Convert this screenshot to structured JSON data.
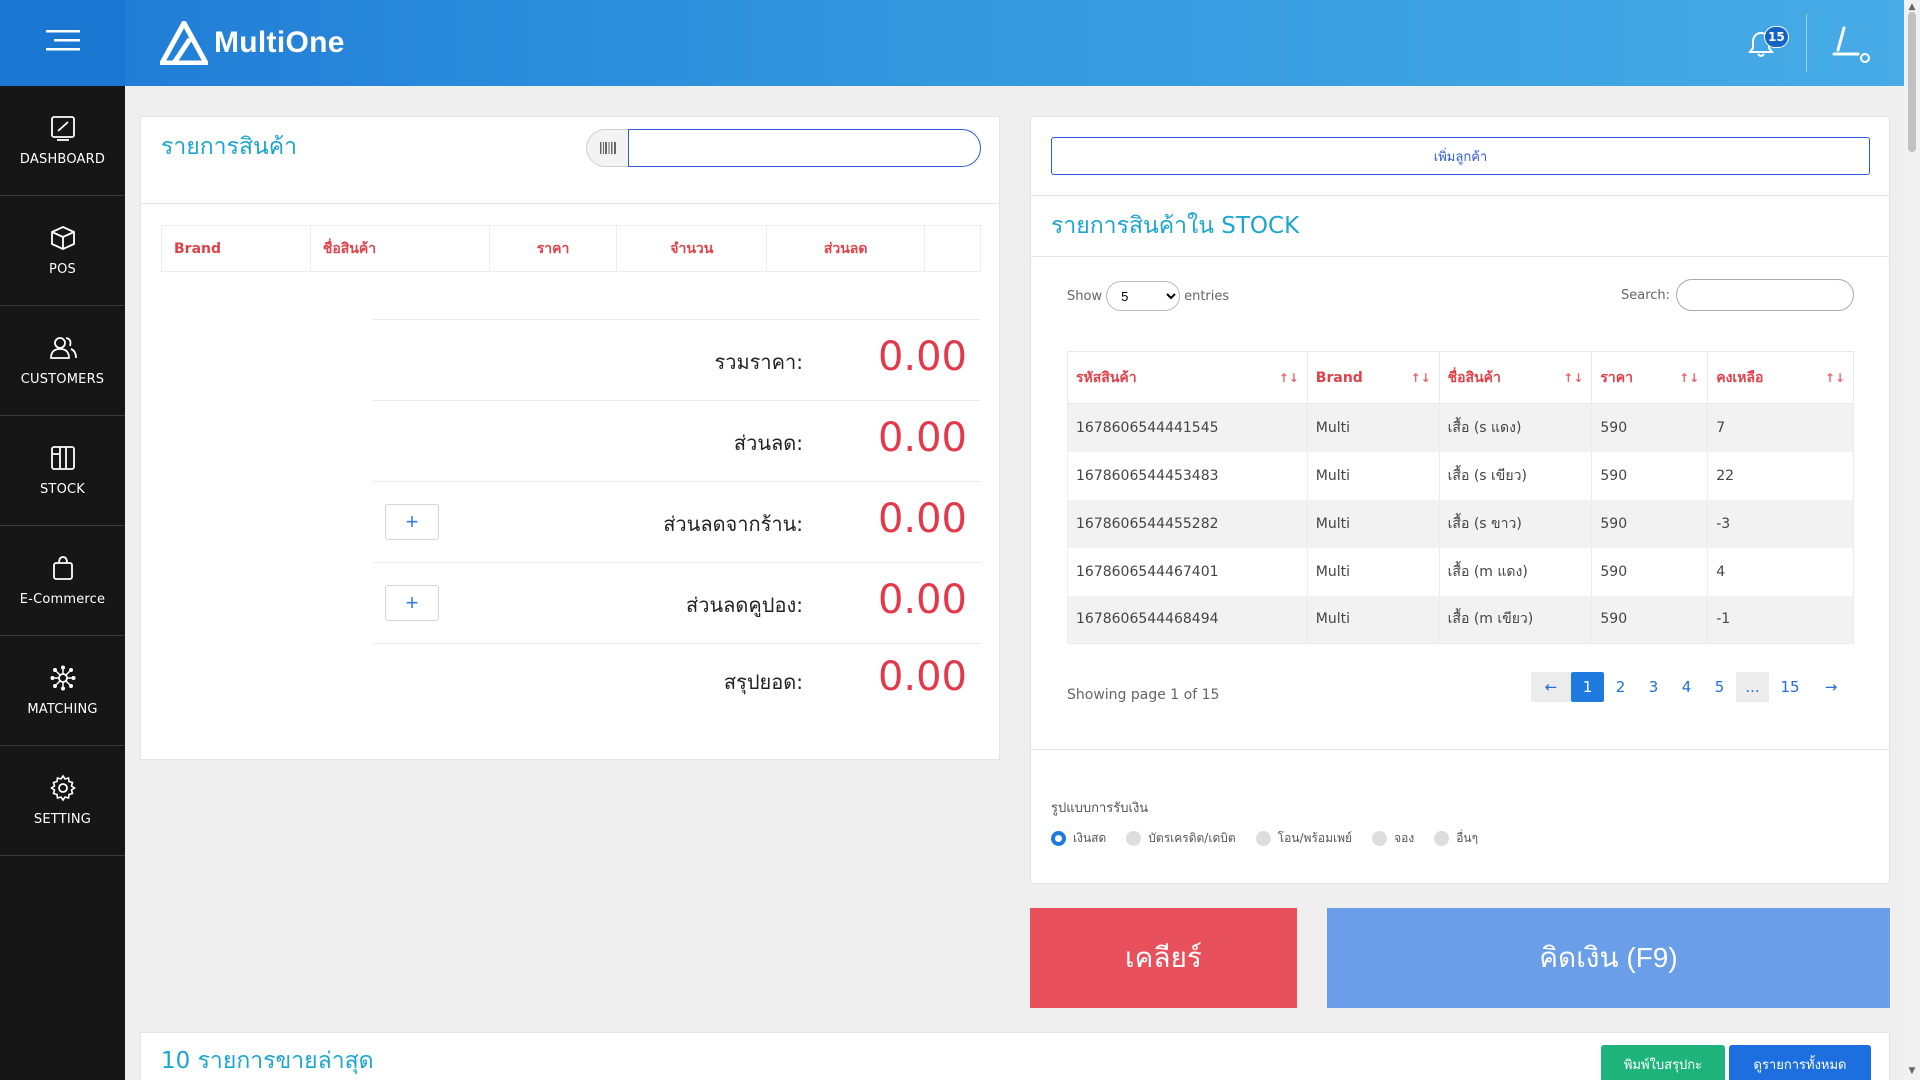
{
  "header": {
    "brand": "MultiOne",
    "notification_count": "15"
  },
  "sidebar": {
    "items": [
      {
        "label": "DASHBOARD",
        "icon": "dashboard-icon"
      },
      {
        "label": "POS",
        "icon": "box-icon"
      },
      {
        "label": "CUSTOMERS",
        "icon": "users-icon"
      },
      {
        "label": "STOCK",
        "icon": "columns-icon"
      },
      {
        "label": "E-Commerce",
        "icon": "shopping-bag-icon"
      },
      {
        "label": "MATCHING",
        "icon": "network-icon"
      },
      {
        "label": "SETTING",
        "icon": "gear-icon"
      }
    ]
  },
  "cart": {
    "title": "รายการสินค้า",
    "columns": [
      "Brand",
      "ชื่อสินค้า",
      "ราคา",
      "จำนวน",
      "ส่วนลด",
      ""
    ],
    "summary": [
      {
        "label": "รวมราคา:",
        "value": "0.00"
      },
      {
        "label": "ส่วนลด:",
        "value": "0.00"
      },
      {
        "label": "ส่วนลดจากร้าน:",
        "value": "0.00"
      },
      {
        "label": "ส่วนลดคูปอง:",
        "value": "0.00"
      },
      {
        "label": "สรุปยอด:",
        "value": "0.00"
      }
    ],
    "plus_label": "+"
  },
  "stock": {
    "add_customer_label": "เพิ่มลูกค้า",
    "title": "รายการสินค้าใน STOCK",
    "show_label": "Show",
    "entries_label": "entries",
    "page_size": "5",
    "search_label": "Search:",
    "columns": [
      "รหัสสินค้า",
      "Brand",
      "ชื่อสินค้า",
      "ราคา",
      "คงเหลือ"
    ],
    "rows": [
      [
        "1678606544441545",
        "Multi",
        "เสื้อ (s แดง)",
        "590",
        "7"
      ],
      [
        "1678606544453483",
        "Multi",
        "เสื้อ (s เขียว)",
        "590",
        "22"
      ],
      [
        "1678606544455282",
        "Multi",
        "เสื้อ (s ขาว)",
        "590",
        "-3"
      ],
      [
        "1678606544467401",
        "Multi",
        "เสื้อ (m แดง)",
        "590",
        "4"
      ],
      [
        "1678606544468494",
        "Multi",
        "เสื้อ (m เขียว)",
        "590",
        "-1"
      ]
    ],
    "showing": "Showing page 1 of 15",
    "pages": [
      "1",
      "2",
      "3",
      "4",
      "5",
      "...",
      "15"
    ],
    "prev": "←",
    "next": "→"
  },
  "payment": {
    "title": "รูปแบบการรับเงิน",
    "options": [
      "เงินสด",
      "บัตรเครดิต/เดบิต",
      "โอน/พร้อมเพย์",
      "จอง",
      "อื่นๆ"
    ],
    "selected": "เงินสด"
  },
  "actions": {
    "clear_label": "เคลียร์",
    "pay_label": "คิดเงิน (F9)"
  },
  "recent": {
    "title": "10 รายการขายล่าสุด",
    "print_label": "พิมพ์ใบสรุปกะ",
    "all_label": "ดูรายการทั้งหมด"
  },
  "colors": {
    "header": "#2f8fdb",
    "sidebar": "#161616",
    "accent_red": "#e4394a",
    "accent_blue": "#1f7ae0",
    "title_cyan": "#1aa6cf"
  }
}
